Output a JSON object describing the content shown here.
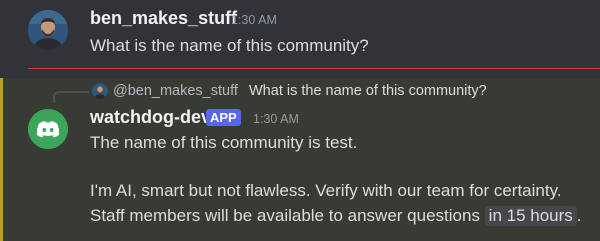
{
  "first_message": {
    "author": "ben_makes_stuff",
    "timestamp": "1:30 AM",
    "text": "What is the name of this community?"
  },
  "bot_message": {
    "reply": {
      "author": "@ben_makes_stuff",
      "text": "What is the name of this community?"
    },
    "author": "watchdog-dev",
    "badge": "APP",
    "timestamp": "1:30 AM",
    "lines": {
      "answer": "The name of this community is test.",
      "disclaimer": "I'm AI, smart but not flawless. Verify with our team for certainty.",
      "staff_prefix": "Staff members will be available to answer questions",
      "staff_time": "in 15 hours",
      "staff_suffix": "."
    }
  },
  "colors": {
    "background": "#313338",
    "highlight_background": "#383a34",
    "highlight_border": "#c29a2a",
    "new_divider": "#d23c3c",
    "app_badge": "#5865f2",
    "bot_avatar": "#3ba55c"
  },
  "icons": {
    "user_avatar": "user-avatar",
    "bot_avatar": "discord-logo-icon"
  }
}
